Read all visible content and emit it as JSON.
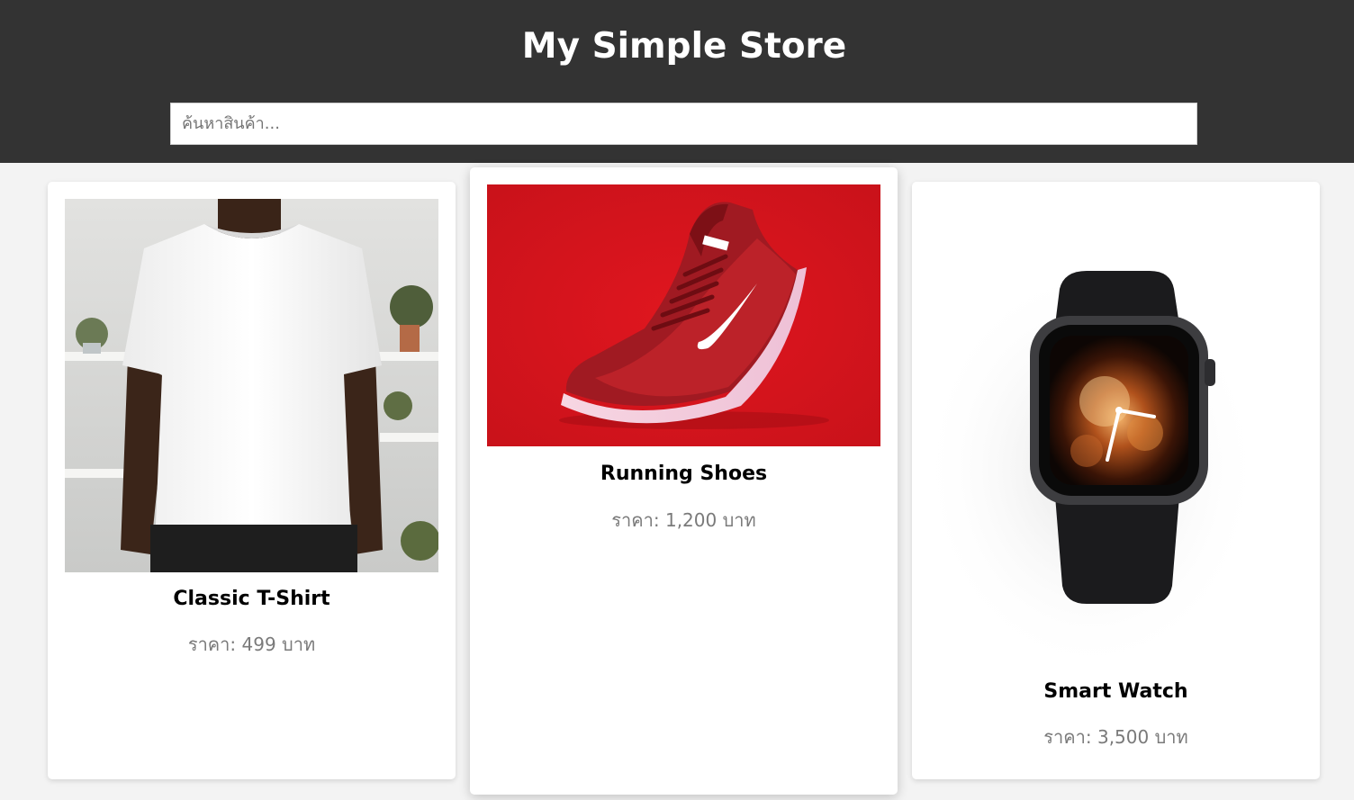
{
  "header": {
    "title": "My Simple Store",
    "background": "#333333"
  },
  "search": {
    "placeholder": "ค้นหาสินค้า...",
    "value": ""
  },
  "products": [
    {
      "name": "Classic T-Shirt",
      "price": "ราคา: 499 บาท",
      "image": "white-tshirt-photo"
    },
    {
      "name": "Running Shoes",
      "price": "ราคา: 1,200 บาท",
      "image": "red-sneaker-photo"
    },
    {
      "name": "Smart Watch",
      "price": "ราคา: 3,500 บาท",
      "image": "smartwatch-photo"
    }
  ],
  "colors": {
    "page_bg": "#f3f3f3",
    "card_bg": "#ffffff",
    "price_text": "#7a7a7a",
    "shoe_bg": "#d2141c"
  }
}
